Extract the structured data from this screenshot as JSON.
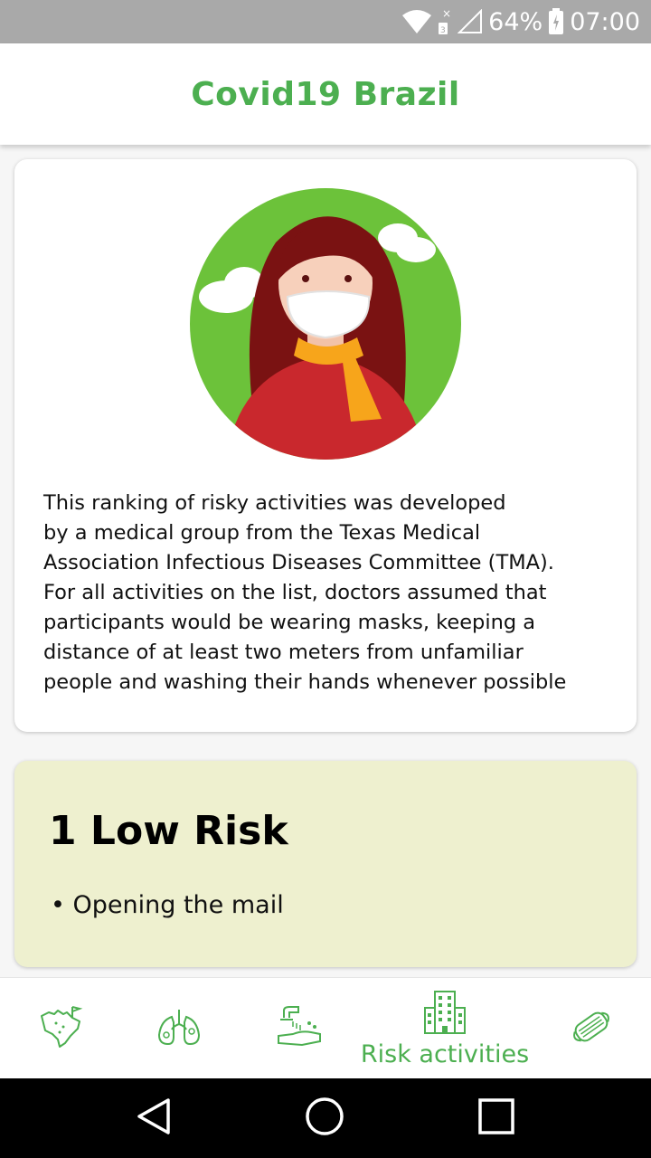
{
  "status_bar": {
    "battery": "64%",
    "time": "07:00",
    "icons": [
      "wifi-icon",
      "no-sim-icon",
      "signal-icon",
      "battery-icon"
    ]
  },
  "app_bar": {
    "title": "Covid19 Brazil"
  },
  "intro_card": {
    "illustration": "woman-wearing-mask-illustration",
    "lines": [
      "This ranking of risky activities was developed",
      "by a medical group from the Texas Medical",
      "Association Infectious Diseases Committee (TMA).",
      "For all activities on the list, doctors assumed that",
      "participants would be wearing masks, keeping a",
      "distance of at least two meters from unfamiliar",
      "people and washing their hands whenever possible"
    ]
  },
  "risk_card": {
    "title": "1 Low Risk",
    "items": [
      "• Opening the mail"
    ]
  },
  "bottom_nav": {
    "items": [
      {
        "icon": "brazil-map-icon",
        "label": ""
      },
      {
        "icon": "lungs-icon",
        "label": ""
      },
      {
        "icon": "hand-washing-icon",
        "label": ""
      },
      {
        "icon": "buildings-icon",
        "label": "Risk activities",
        "active": true
      },
      {
        "icon": "face-mask-icon",
        "label": ""
      }
    ]
  },
  "colors": {
    "accent": "#4caf50",
    "status_bar": "#a9a9a9",
    "risk_card_bg": "#eef0cf"
  }
}
